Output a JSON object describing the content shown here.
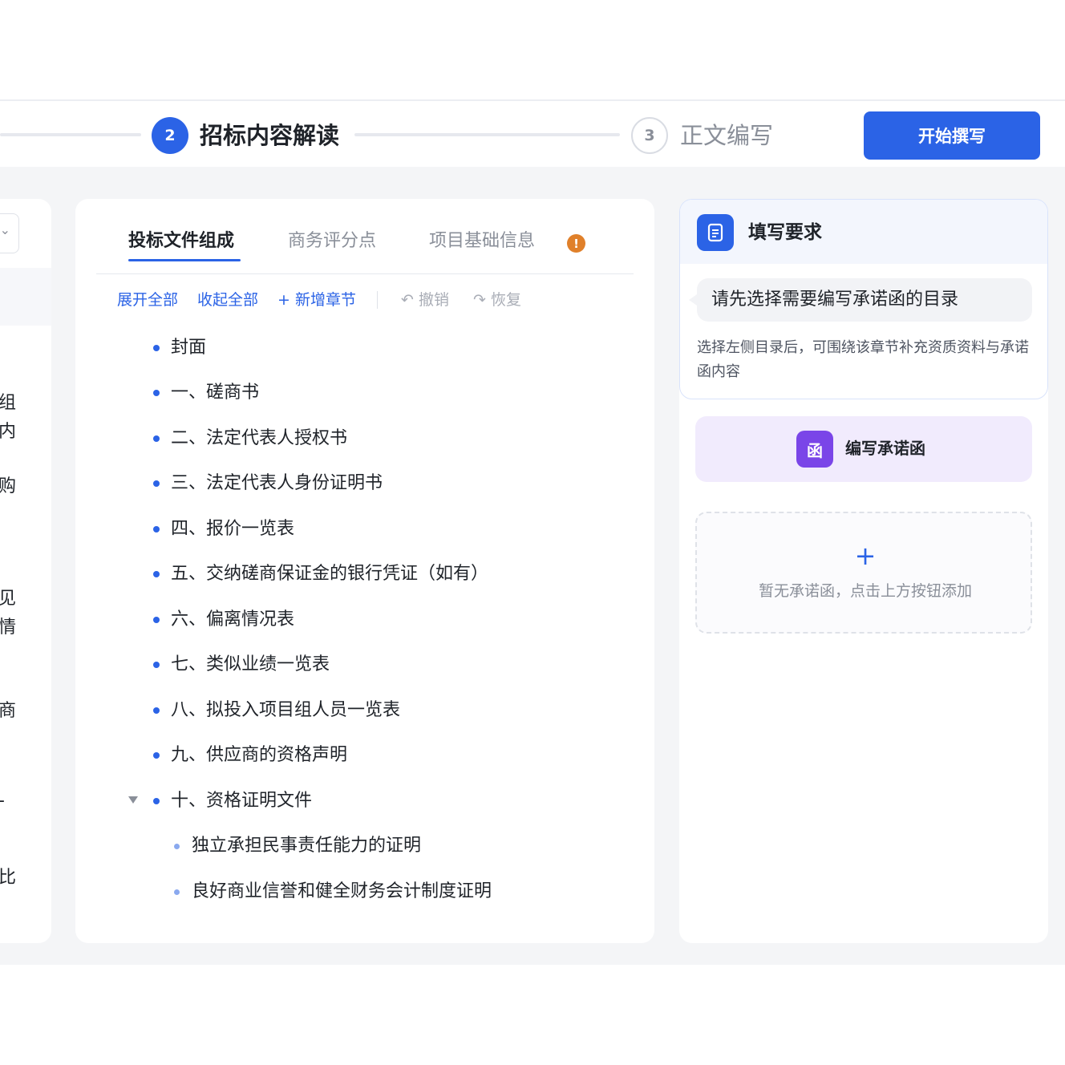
{
  "steps": {
    "current_number": "2",
    "current_label": "招标内容解读",
    "next_number": "3",
    "next_label": "正文编写",
    "start_button": "开始撰写"
  },
  "left_panel": {
    "fragments": [
      "组",
      "内",
      "购",
      "见",
      "情",
      "商",
      "-",
      "比"
    ]
  },
  "tabs": [
    {
      "label": "投标文件组成",
      "active": true
    },
    {
      "label": "商务评分点",
      "active": false
    },
    {
      "label": "项目基础信息",
      "active": false,
      "badge": "!"
    }
  ],
  "toolbar": {
    "expand_all": "展开全部",
    "collapse_all": "收起全部",
    "add_chapter": "+ 新增章节",
    "undo": "撤销",
    "redo": "恢复"
  },
  "tree": [
    {
      "label": "封面",
      "level": 1
    },
    {
      "label": "一、磋商书",
      "level": 1
    },
    {
      "label": "二、法定代表人授权书",
      "level": 1
    },
    {
      "label": "三、法定代表人身份证明书",
      "level": 1
    },
    {
      "label": "四、报价一览表",
      "level": 1
    },
    {
      "label": "五、交纳磋商保证金的银行凭证（如有）",
      "level": 1
    },
    {
      "label": "六、偏离情况表",
      "level": 1
    },
    {
      "label": "七、类似业绩一览表",
      "level": 1
    },
    {
      "label": "八、拟投入项目组人员一览表",
      "level": 1
    },
    {
      "label": "九、供应商的资格声明",
      "level": 1
    },
    {
      "label": "十、资格证明文件",
      "level": 1,
      "expanded": true
    },
    {
      "label": "独立承担民事责任能力的证明",
      "level": 2
    },
    {
      "label": "良好商业信誉和健全财务会计制度证明",
      "level": 2
    }
  ],
  "requirements": {
    "title": "填写要求",
    "bubble": "请先选择需要编写承诺函的目录",
    "description": "选择左侧目录后，可围绕该章节补充资质资料与承诺函内容"
  },
  "write_letter": {
    "icon_char": "函",
    "label": "编写承诺函"
  },
  "empty_state": {
    "plus": "+",
    "text": "暂无承诺函，点击上方按钮添加"
  },
  "colors": {
    "primary": "#2b63e6",
    "warning": "#e0802a",
    "purple": "#7a45e8"
  }
}
